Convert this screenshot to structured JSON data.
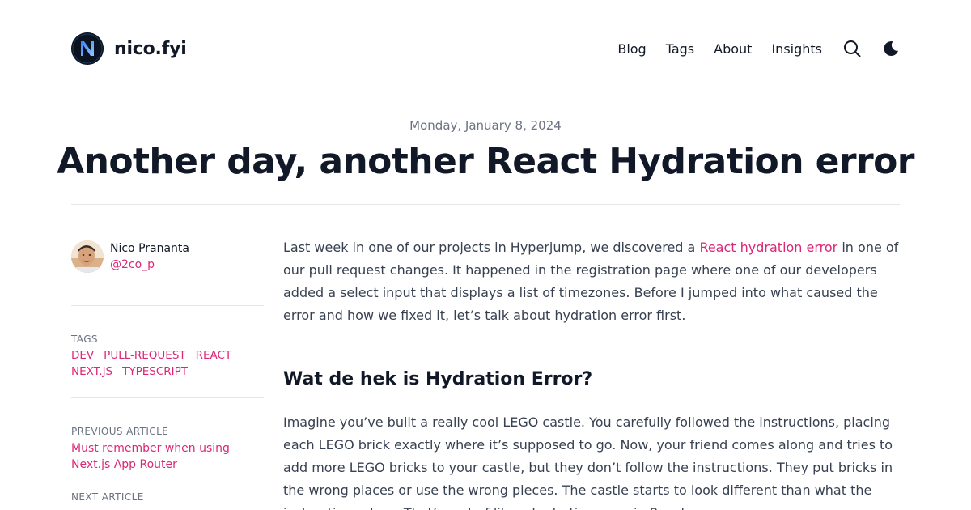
{
  "header": {
    "site_name": "nico.fyi",
    "logo_icon": "n-monogram-logo",
    "nav": [
      {
        "label": "Blog"
      },
      {
        "label": "Tags"
      },
      {
        "label": "About"
      },
      {
        "label": "Insights"
      }
    ],
    "search_icon": "search-icon",
    "theme_icon": "moon-icon"
  },
  "post": {
    "date": "Monday, January 8, 2024",
    "title": "Another day, another React Hydration error"
  },
  "sidebar": {
    "author_name": "Nico Prananta",
    "author_handle": "@2co_p",
    "tags_label": "TAGS",
    "tags": [
      "DEV",
      "PULL-REQUEST",
      "REACT",
      "NEXT.JS",
      "TYPESCRIPT"
    ],
    "previous_label": "PREVIOUS ARTICLE",
    "previous_title": "Must remember when using Next.js App Router",
    "next_label": "NEXT ARTICLE"
  },
  "article": {
    "p1_before": "Last week in one of our projects in Hyperjump, we discovered a ",
    "p1_link": "React hydration error",
    "p1_after": " in one of our pull request changes. It happened in the registration page where one of our developers added a select input that displays a list of timezones. Before I jumped into what caused the error and how we fixed it, let’s talk about hydration error first.",
    "h2": "Wat de hek is Hydration Error?",
    "p2": "Imagine you’ve built a really cool LEGO castle. You carefully followed the instructions, placing each LEGO brick exactly where it’s supposed to go. Now, your friend comes along and tries to add more LEGO bricks to your castle, but they don’t follow the instructions. They put bricks in the wrong places or use the wrong pieces. The castle starts to look different than what the instructions show. That’s sort of like a hydration error in React."
  },
  "colors": {
    "accent": "#db2777",
    "text": "#111827",
    "muted": "#6b7280",
    "divider": "#e5e7eb"
  }
}
